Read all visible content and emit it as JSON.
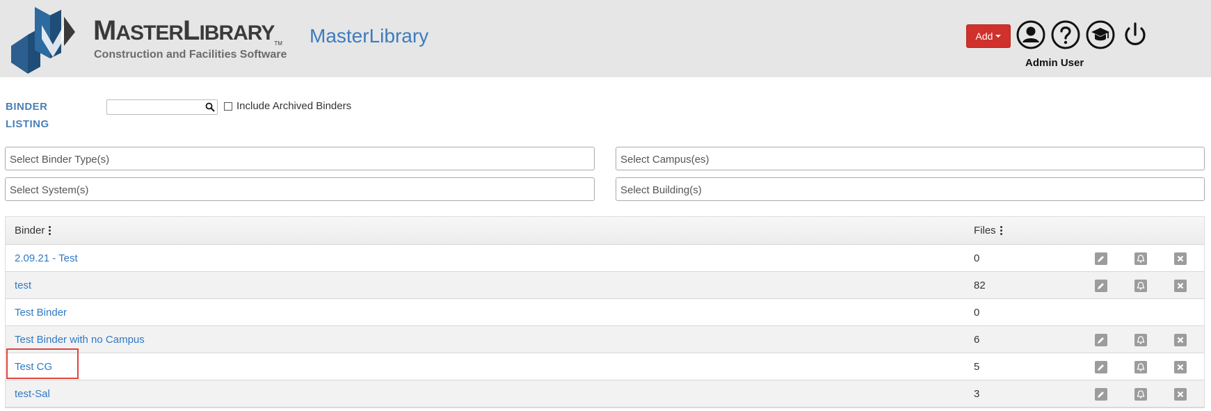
{
  "header": {
    "logo_title_part1": "M",
    "logo_title_part2": "ASTER",
    "logo_title_part3": "L",
    "logo_title_part4": "IBRARY",
    "logo_tm": "TM",
    "logo_subtitle": "Construction and Facilities Software",
    "brand_name": "MasterLibrary",
    "add_label": "Add",
    "user_name": "Admin User",
    "icons": [
      "user-profile-icon",
      "help-icon",
      "training-icon",
      "power-icon"
    ]
  },
  "listing": {
    "title": "BINDER LISTING",
    "search_placeholder": "",
    "archived_label": "Include Archived Binders"
  },
  "filters": {
    "binder_type": "Select Binder Type(s)",
    "campus": "Select Campus(es)",
    "system": "Select System(s)",
    "building": "Select Building(s)"
  },
  "table": {
    "columns": [
      "Binder",
      "Files"
    ],
    "rows": [
      {
        "binder": "2.09.21 - Test",
        "files": "0",
        "actions": true
      },
      {
        "binder": "test",
        "files": "82",
        "actions": true
      },
      {
        "binder": "Test Binder",
        "files": "0",
        "actions": false
      },
      {
        "binder": "Test Binder with no Campus",
        "files": "6",
        "actions": true
      },
      {
        "binder": "Test CG",
        "files": "5",
        "actions": true
      },
      {
        "binder": "test-Sal",
        "files": "3",
        "actions": true
      }
    ]
  },
  "colors": {
    "header_bg": "#e6e6e6",
    "add_button": "#d0312d",
    "link": "#2f79c4",
    "listing_title": "#4a7fb8",
    "brand_blue": "#3d7bbf",
    "highlight": "#e0433b"
  }
}
